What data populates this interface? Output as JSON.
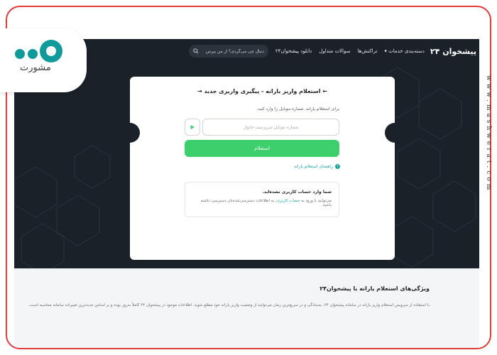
{
  "logo": {
    "wordmark": "مشورت"
  },
  "watermark": "www.mashwerat.com",
  "topbar": {
    "brand": "پیشخوان ۲۴",
    "nav": [
      "دسته‌بندی خدمات",
      "تراکنش‌ها",
      "سوالات متداول",
      "دانلود پیشخوان۲۴"
    ],
    "search_placeholder": "دنبال چی می‌گردی؟ از من بپرس"
  },
  "card": {
    "title": "← استعلام واریز یارانه - پیگیری واریزی جدید →",
    "description": "برای استعلام یارانه، شماره موبایل را وارد کنید.",
    "phone_placeholder": "شماره موبایل سرپرست خانوار",
    "submit_label": "استعلام",
    "guide_link": "راهنمای استعلام یارانه",
    "notice": {
      "title": "شما وارد حساب کاربری نشده‌اید.",
      "text_before": "می‌توانید با ورود به ",
      "link": "حساب کاربری",
      "text_after": "، به اطلاعات دسترسی‌شده‌تان دسترسی داشته باشید."
    }
  },
  "features": {
    "title": "ویژگی‌های استعلام یارانه با پیشخوان۲۴",
    "text": "با استفاده از سرویس استعلام واریز یارانه در سامانه پیشخوان ۲۴، به‌سادگی و در سریع‌ترین زمان می‌توانید از وضعیت واریز یارانه خود مطلع شوید. اطلاعات موجود در پیشخوان ۲۴ کاملاً به‌روز بوده و بر اساس جدیدترین تغییرات سامانه محاسبه است."
  },
  "colors": {
    "dark_bg": "#1b2129",
    "accent_green": "#3ccf6b",
    "link_teal": "#1aa3a3",
    "frame_red": "#e23b3b",
    "logo_teal": "#0f9b9b"
  }
}
